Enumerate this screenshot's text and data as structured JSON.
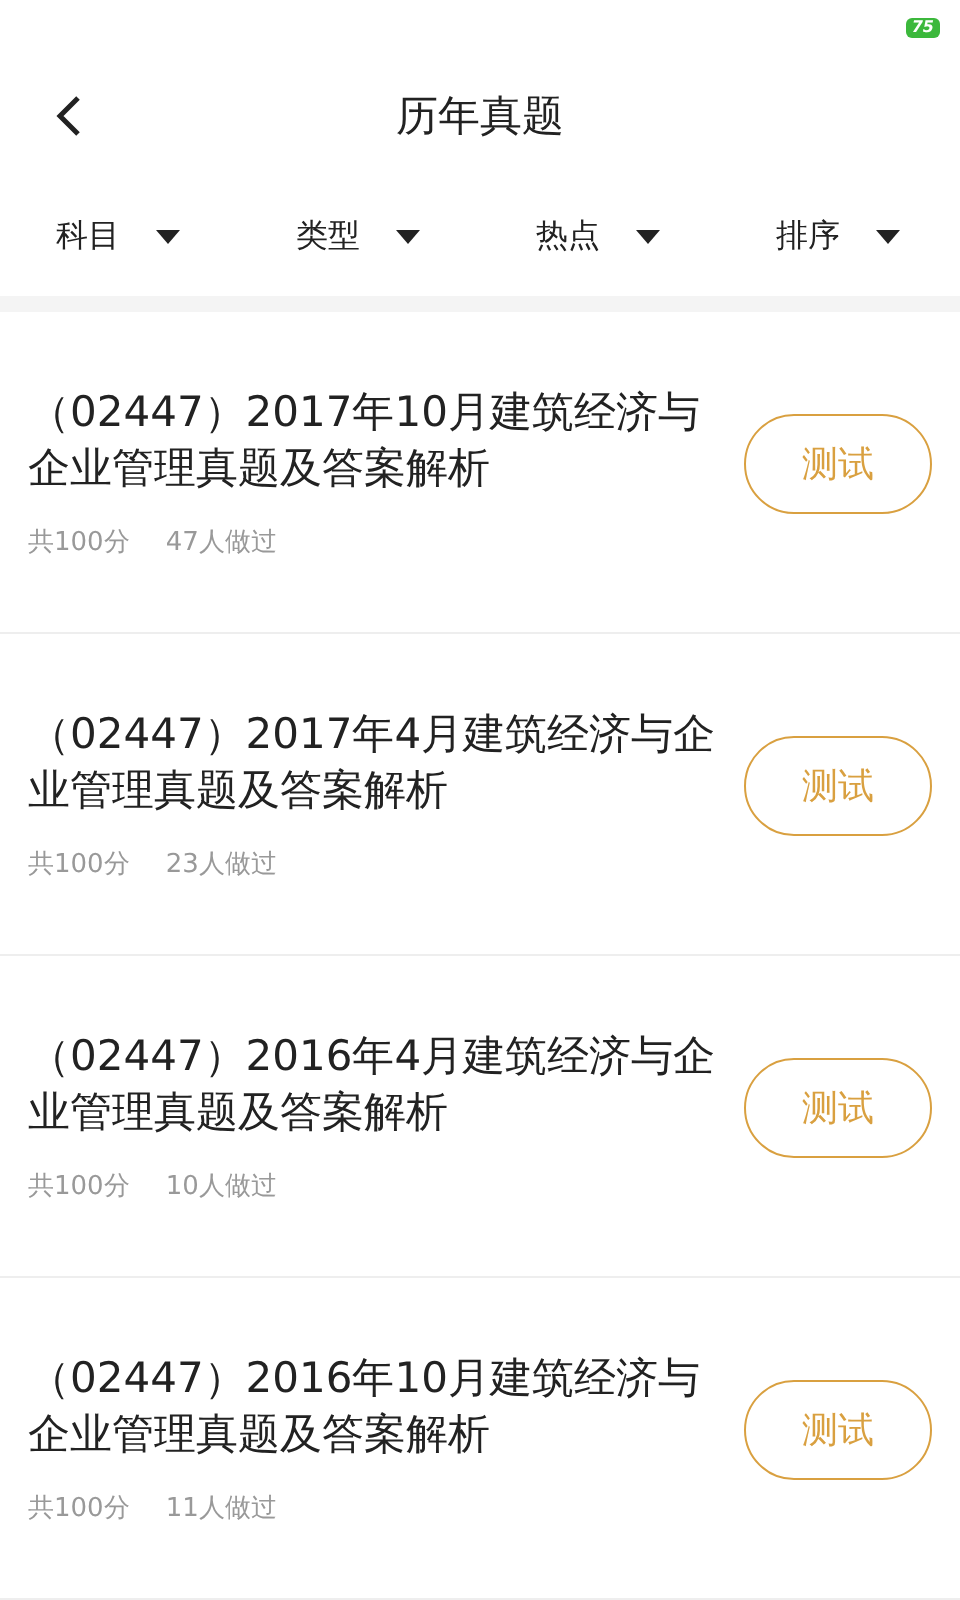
{
  "status_bar": {
    "battery": "75"
  },
  "header": {
    "title": "历年真题"
  },
  "filters": [
    {
      "label": "科目"
    },
    {
      "label": "类型"
    },
    {
      "label": "热点"
    },
    {
      "label": "排序"
    }
  ],
  "papers": [
    {
      "title": "（02447）2017年10月建筑经济与企业管理真题及答案解析",
      "score": "共100分",
      "count": "47人做过",
      "button": "测试"
    },
    {
      "title": "（02447）2017年4月建筑经济与企业管理真题及答案解析",
      "score": "共100分",
      "count": "23人做过",
      "button": "测试"
    },
    {
      "title": "（02447）2016年4月建筑经济与企业管理真题及答案解析",
      "score": "共100分",
      "count": "10人做过",
      "button": "测试"
    },
    {
      "title": "（02447）2016年10月建筑经济与企业管理真题及答案解析",
      "score": "共100分",
      "count": "11人做过",
      "button": "测试"
    }
  ]
}
